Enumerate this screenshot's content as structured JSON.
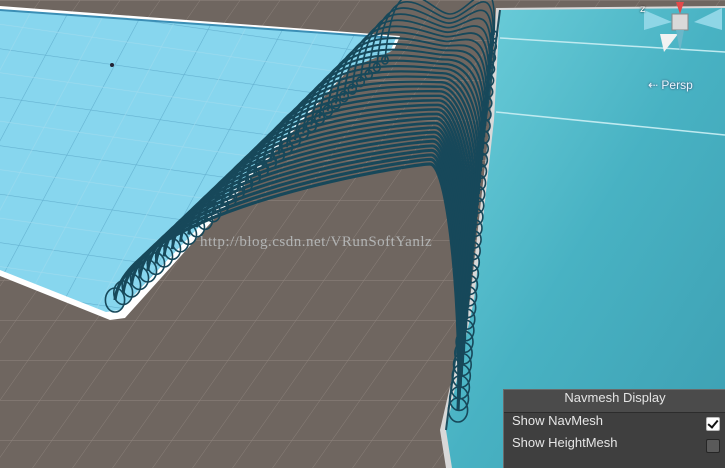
{
  "scene_view": {
    "gizmo_axis_label": "z",
    "projection_label": "Persp",
    "watermark": "http://blog.csdn.net/VRunSoftYanlz"
  },
  "navmesh_panel": {
    "title": "Navmesh Display",
    "rows": [
      {
        "label": "Show NavMesh",
        "checked": true
      },
      {
        "label": "Show HeightMesh",
        "checked": false
      }
    ]
  },
  "colors": {
    "ground": "#6f6660",
    "navmesh_left": "#87d6ee",
    "navmesh_right": "#4fb8c8",
    "spline_rings": "#17485a",
    "panel_bg": "#3f3f3f"
  }
}
